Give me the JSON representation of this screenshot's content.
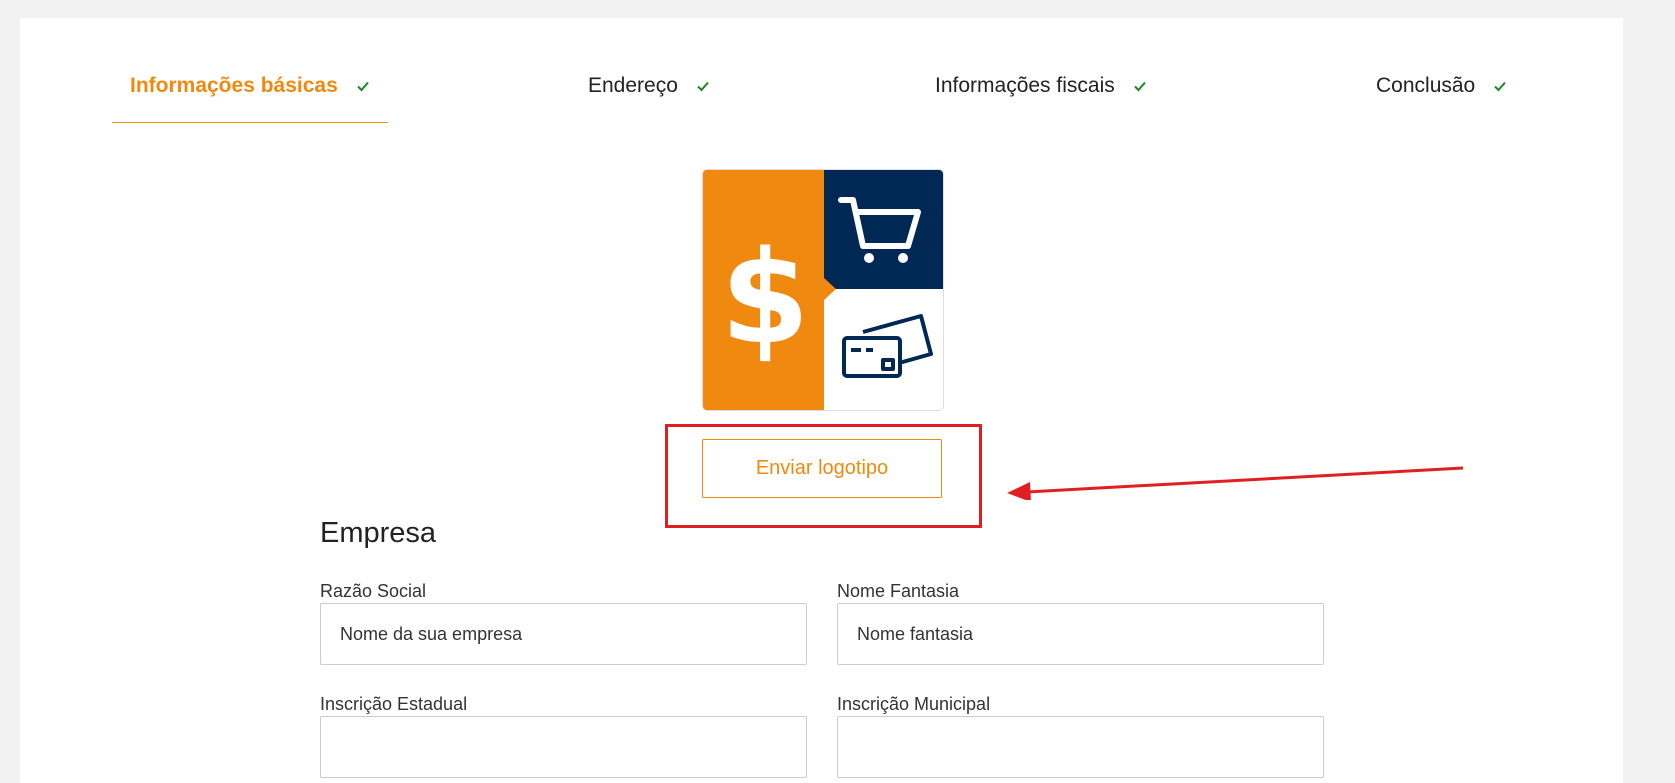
{
  "steps": [
    {
      "label": "Informações básicas",
      "active": true
    },
    {
      "label": "Endereço",
      "active": false
    },
    {
      "label": "Informações fiscais",
      "active": false
    },
    {
      "label": "Conclusão",
      "active": false
    }
  ],
  "logo": {
    "symbol": "$",
    "icons": [
      "dollar-icon",
      "shopping-cart-icon",
      "credit-card-icon"
    ]
  },
  "upload": {
    "label": "Enviar logotipo"
  },
  "section": {
    "title": "Empresa"
  },
  "fields": {
    "razao_social": {
      "label": "Razão Social",
      "placeholder": "Nome da sua empresa"
    },
    "nome_fantasia": {
      "label": "Nome Fantasia",
      "placeholder": "Nome fantasia"
    },
    "inscricao_estadual": {
      "label": "Inscrição Estadual",
      "placeholder": ""
    },
    "inscricao_municipal": {
      "label": "Inscrição Municipal",
      "placeholder": ""
    }
  },
  "colors": {
    "accent": "#f0890f",
    "navy": "#002855",
    "check": "#1a8a1a",
    "annotation": "#e02020",
    "background": "#f2f2f2"
  }
}
